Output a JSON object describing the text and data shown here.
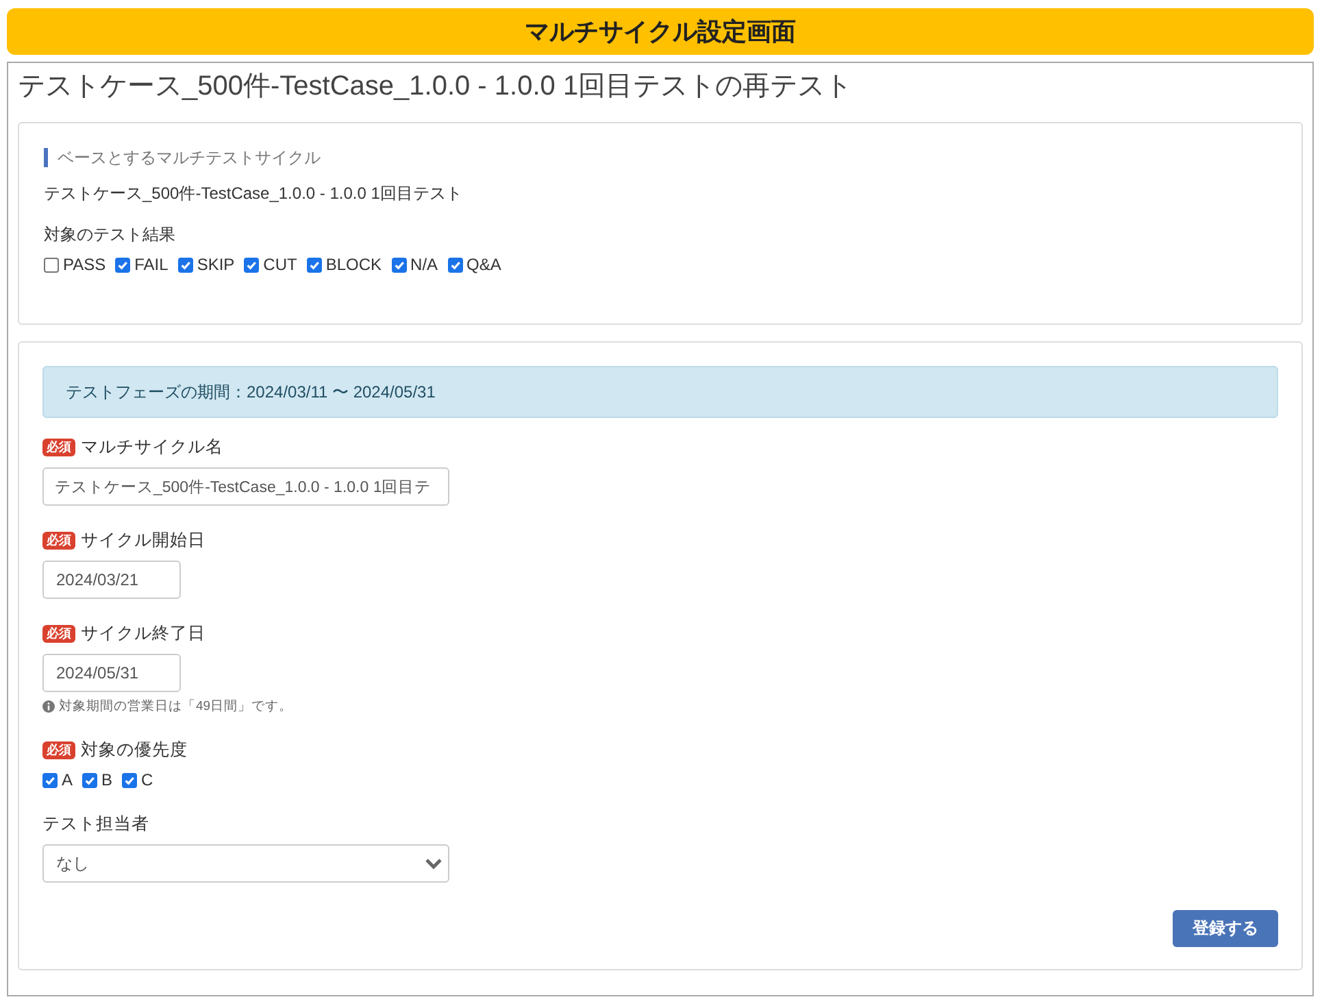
{
  "header": {
    "title": "マルチサイクル設定画面"
  },
  "page_title": "テストケース_500件-TestCase_1.0.0 - 1.0.0 1回目テストの再テスト",
  "base_cycle": {
    "heading": "ベースとするマルチテストサイクル",
    "name": "テストケース_500件-TestCase_1.0.0 - 1.0.0 1回目テスト",
    "results_label": "対象のテスト結果",
    "results": [
      {
        "label": "PASS",
        "checked": false
      },
      {
        "label": "FAIL",
        "checked": true
      },
      {
        "label": "SKIP",
        "checked": true
      },
      {
        "label": "CUT",
        "checked": true
      },
      {
        "label": "BLOCK",
        "checked": true
      },
      {
        "label": "N/A",
        "checked": true
      },
      {
        "label": "Q&A",
        "checked": true
      }
    ]
  },
  "form": {
    "period_notice": "テストフェーズの期間：2024/03/11 〜 2024/05/31",
    "fields": [
      {
        "kind": "text",
        "badge": "必須",
        "label": "マルチサイクル名",
        "value": "テストケース_500件-TestCase_1.0.0 - 1.0.0 1回目テ"
      },
      {
        "kind": "date",
        "badge": "必須",
        "label": "サイクル開始日",
        "value": "2024/03/21"
      },
      {
        "kind": "date",
        "badge": "必須",
        "label": "サイクル終了日",
        "value": "2024/05/31",
        "help": "対象期間の営業日は「49日間」です。"
      },
      {
        "kind": "checks",
        "badge": "必須",
        "label": "対象の優先度",
        "options": [
          {
            "label": "A",
            "checked": true
          },
          {
            "label": "B",
            "checked": true
          },
          {
            "label": "C",
            "checked": true
          }
        ]
      },
      {
        "kind": "select",
        "label": "テスト担当者",
        "value": "なし"
      }
    ],
    "submit": "登録する"
  }
}
